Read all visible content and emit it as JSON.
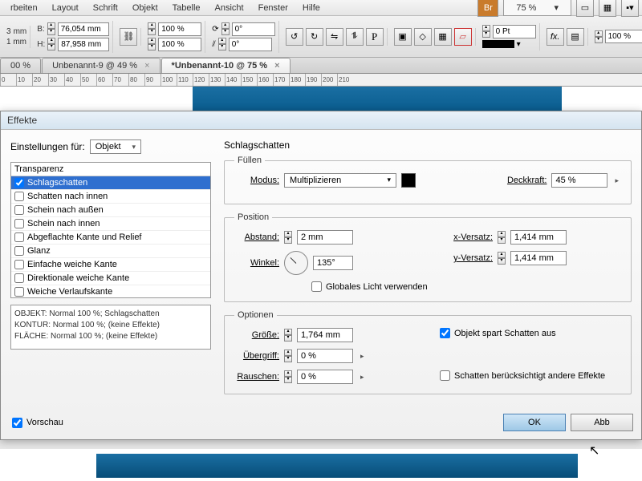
{
  "menu": {
    "items": [
      "rbeiten",
      "Layout",
      "Schrift",
      "Objekt",
      "Tabelle",
      "Ansicht",
      "Fenster",
      "Hilfe"
    ],
    "br": "Br",
    "zoom": "75 %"
  },
  "toolbar": {
    "w_label": "B:",
    "w_val": "76,054 mm",
    "h_label": "H:",
    "h_val": "87,958 mm",
    "x_label": "mm",
    "x_val": "3",
    "percent1": "100 %",
    "percent2": "100 %",
    "angle1": "0°",
    "angle2": "0°",
    "pt": "0 Pt",
    "pct100": "100 %"
  },
  "tabs": {
    "items": [
      "00 %",
      "Unbenannt-9 @ 49 %",
      "*Unbenannt-10 @ 75 %"
    ],
    "active": 2
  },
  "ruler": {
    "marks": [
      "0",
      "10",
      "20",
      "30",
      "40",
      "50",
      "60",
      "70",
      "80",
      "90",
      "100",
      "110",
      "120",
      "130",
      "140",
      "150",
      "160",
      "170",
      "180",
      "190",
      "200",
      "210"
    ]
  },
  "dialog": {
    "title": "Effekte",
    "settings_for_label": "Einstellungen für:",
    "settings_for_value": "Objekt",
    "effects_header": "Transparenz",
    "effects": [
      {
        "label": "Schlagschatten",
        "checked": true,
        "sel": true
      },
      {
        "label": "Schatten nach innen",
        "checked": false
      },
      {
        "label": "Schein nach außen",
        "checked": false
      },
      {
        "label": "Schein nach innen",
        "checked": false
      },
      {
        "label": "Abgeflachte Kante und Relief",
        "checked": false
      },
      {
        "label": "Glanz",
        "checked": false
      },
      {
        "label": "Einfache weiche Kante",
        "checked": false
      },
      {
        "label": "Direktionale weiche Kante",
        "checked": false
      },
      {
        "label": "Weiche Verlaufskante",
        "checked": false
      }
    ],
    "summary": {
      "l1": "OBJEKT: Normal 100 %; Schlagschatten",
      "l2": "KONTUR: Normal 100 %; (keine Effekte)",
      "l3": "FLÄCHE: Normal 100 %; (keine Effekte)"
    },
    "panel_title": "Schlagschatten",
    "fill": {
      "legend": "Füllen",
      "mode_label": "Modus:",
      "mode_value": "Multiplizieren",
      "opacity_label": "Deckkraft:",
      "opacity_value": "45 %"
    },
    "position": {
      "legend": "Position",
      "distance_label": "Abstand:",
      "distance_value": "2 mm",
      "angle_label": "Winkel:",
      "angle_value": "135°",
      "xoff_label": "x-Versatz:",
      "xoff_value": "1,414 mm",
      "yoff_label": "y-Versatz:",
      "yoff_value": "1,414 mm",
      "global_light": "Globales Licht verwenden"
    },
    "options": {
      "legend": "Optionen",
      "size_label": "Größe:",
      "size_value": "1,764 mm",
      "spread_label": "Übergriff:",
      "spread_value": "0 %",
      "noise_label": "Rauschen:",
      "noise_value": "0 %",
      "knockout": "Objekt spart Schatten aus",
      "honors": "Schatten berücksichtigt andere Effekte"
    },
    "preview": "Vorschau",
    "ok": "OK",
    "cancel": "Abb"
  }
}
